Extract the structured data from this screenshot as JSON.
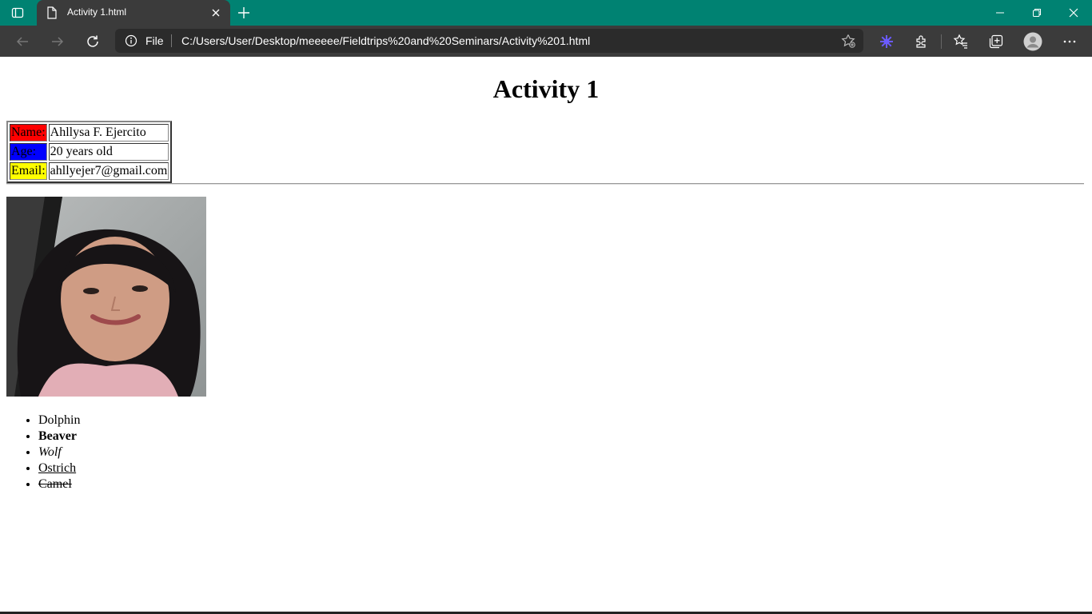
{
  "browser": {
    "tab_title": "Activity 1.html",
    "file_label": "File",
    "url": "C:/Users/User/Desktop/meeeee/Fieldtrips%20and%20Seminars/Activity%201.html",
    "accent_color": "#008272"
  },
  "page": {
    "heading": "Activity 1",
    "info_table": [
      {
        "label": "Name:",
        "value": "Ahllysa F. Ejercito",
        "color": "#ff0000"
      },
      {
        "label": "Age:",
        "value": "20 years old",
        "color": "#0000ff"
      },
      {
        "label": "Email:",
        "value": "ahllyejer7@gmail.com",
        "color": "#ffff00"
      }
    ],
    "animals": [
      "Dolphin",
      "Beaver",
      "Wolf",
      "Ostrich",
      "Camel"
    ]
  }
}
